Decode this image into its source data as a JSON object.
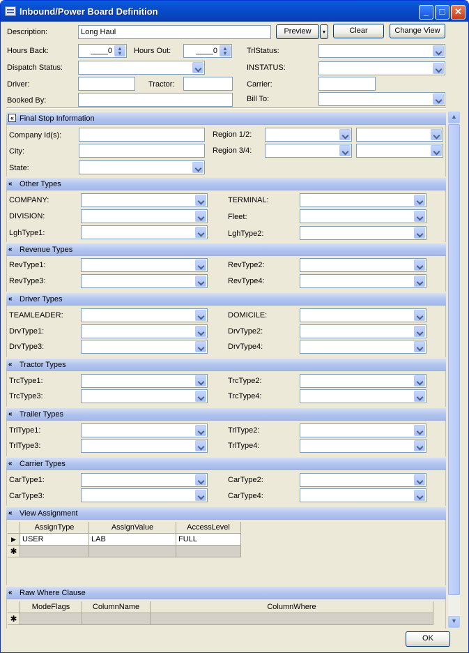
{
  "window": {
    "title": "Inbound/Power Board Definition"
  },
  "header": {
    "description_label": "Description:",
    "description_value": "Long Haul",
    "preview_label": "Preview",
    "clear_label": "Clear",
    "change_view_label": "Change View",
    "hours_back_label": "Hours Back:",
    "hours_back_value": "____0",
    "hours_out_label": "Hours Out:",
    "hours_out_value": "____0",
    "trlstatus_label": "TrlStatus:",
    "dispatch_status_label": "Dispatch Status:",
    "instatus_label": "INSTATUS:",
    "driver_label": "Driver:",
    "tractor_label": "Tractor:",
    "carrier_label": "Carrier:",
    "booked_by_label": "Booked By:",
    "bill_to_label": "Bill To:"
  },
  "final_stop": {
    "title": "Final Stop Information",
    "company_label": "Company Id(s):",
    "region12_label": "Region 1/2:",
    "city_label": "City:",
    "region34_label": "Region 3/4:",
    "state_label": "State:"
  },
  "other_types": {
    "title": "Other Types",
    "company": "COMPANY:",
    "terminal": "TERMINAL:",
    "division": "DIVISION:",
    "fleet": "Fleet:",
    "lghtype1": "LghType1:",
    "lghtype2": "LghType2:"
  },
  "revenue_types": {
    "title": "Revenue Types",
    "r1": "RevType1:",
    "r2": "RevType2:",
    "r3": "RevType3:",
    "r4": "RevType4:"
  },
  "driver_types": {
    "title": "Driver Types",
    "teamleader": "TEAMLEADER:",
    "domicile": "DOMICILE:",
    "d1": "DrvType1:",
    "d2": "DrvType2:",
    "d3": "DrvType3:",
    "d4": "DrvType4:"
  },
  "tractor_types": {
    "title": "Tractor Types",
    "t1": "TrcType1:",
    "t2": "TrcType2:",
    "t3": "TrcType3:",
    "t4": "TrcType4:"
  },
  "trailer_types": {
    "title": "Trailer Types",
    "t1": "TrlType1:",
    "t2": "TrlType2:",
    "t3": "TrlType3:",
    "t4": "TrlType4:"
  },
  "carrier_types": {
    "title": "Carrier Types",
    "c1": "CarType1:",
    "c2": "CarType2:",
    "c3": "CarType3:",
    "c4": "CarType4:"
  },
  "view_assignment": {
    "title": "View Assignment",
    "columns": [
      "AssignType",
      "AssignValue",
      "AccessLevel"
    ],
    "rows": [
      [
        "USER",
        "LAB",
        "FULL"
      ]
    ]
  },
  "raw_where": {
    "title": "Raw Where Clause",
    "columns": [
      "ModeFlags",
      "ColumnName",
      "ColumnWhere"
    ]
  },
  "footer": {
    "ok_label": "OK"
  },
  "icons": {
    "row_pointer": "▶",
    "new_row": "✱",
    "collapse": "«"
  }
}
